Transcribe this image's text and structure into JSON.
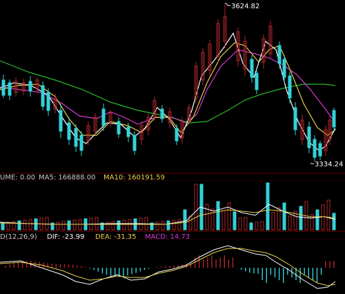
{
  "colors": {
    "background": "#000000",
    "divider": "#6e0000",
    "up": "#b0272b",
    "down": "#33d1d8",
    "ma_white": "#ffffff",
    "ma_yellow": "#e8d34a",
    "ma_magenta": "#d83ad8",
    "ma_green": "#2bb82b"
  },
  "price_panel": {
    "high_label": "3624.82",
    "low_label": "3334.24"
  },
  "volume_panel": {
    "header": "UME: 0.00",
    "ma5_label": "MA5: 166888.00",
    "ma10_label": "MA10: 160191.59"
  },
  "macd_panel": {
    "header": "D(12,26,9)",
    "dif_label": "DIF: -23.99",
    "dea_label": "DEA: -31.35",
    "macd_label": "MACD: 14.73"
  }
}
